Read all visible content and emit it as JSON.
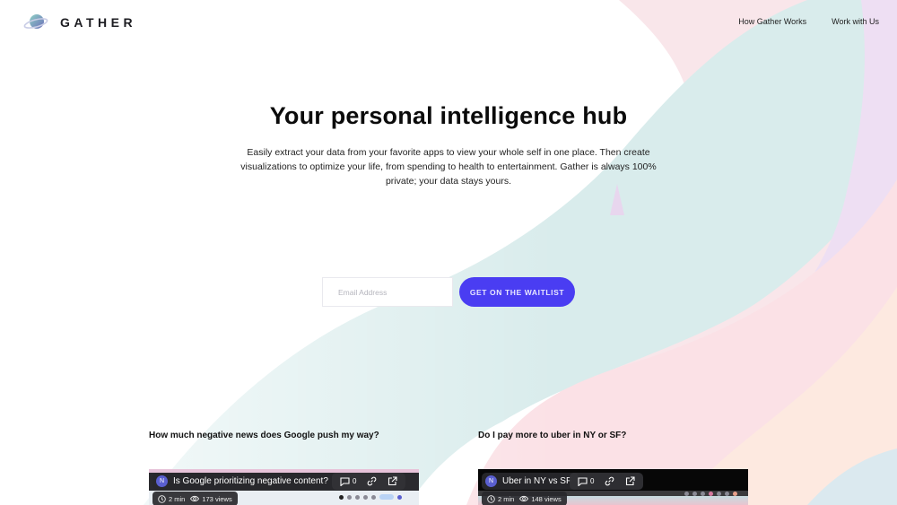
{
  "header": {
    "logo_text": "GATHER",
    "nav": [
      {
        "label": "How Gather Works"
      },
      {
        "label": "Work with Us"
      }
    ]
  },
  "hero": {
    "title": "Your personal intelligence hub",
    "description": "Easily extract your data from your favorite apps to view your whole self in one place. Then create visualizations to optimize your life, from spending to health to entertainment. Gather is always 100% private; your data stays yours."
  },
  "signup": {
    "email_placeholder": "Email Address",
    "email_value": "",
    "cta_label": "GET ON THE WAITLIST"
  },
  "cards": [
    {
      "question": "How much negative news does Google push my way?",
      "video": {
        "avatar_initial": "N",
        "title": "Is Google prioritizing negative content?",
        "comments": "0",
        "duration": "2 min",
        "views": "173 views"
      }
    },
    {
      "question": "Do I pay more to uber in NY or SF?",
      "video": {
        "avatar_initial": "N",
        "title": "Uber in NY vs SF",
        "comments": "0",
        "duration": "2 min",
        "views": "148 views"
      }
    }
  ],
  "colors": {
    "accent": "#4a3df2",
    "text": "#0b0b0b",
    "bg_teal": "#d8ecec",
    "bg_pink": "#fbe1e6",
    "bg_lavender": "#efe0f3",
    "bg_peach": "#fde9e0"
  }
}
